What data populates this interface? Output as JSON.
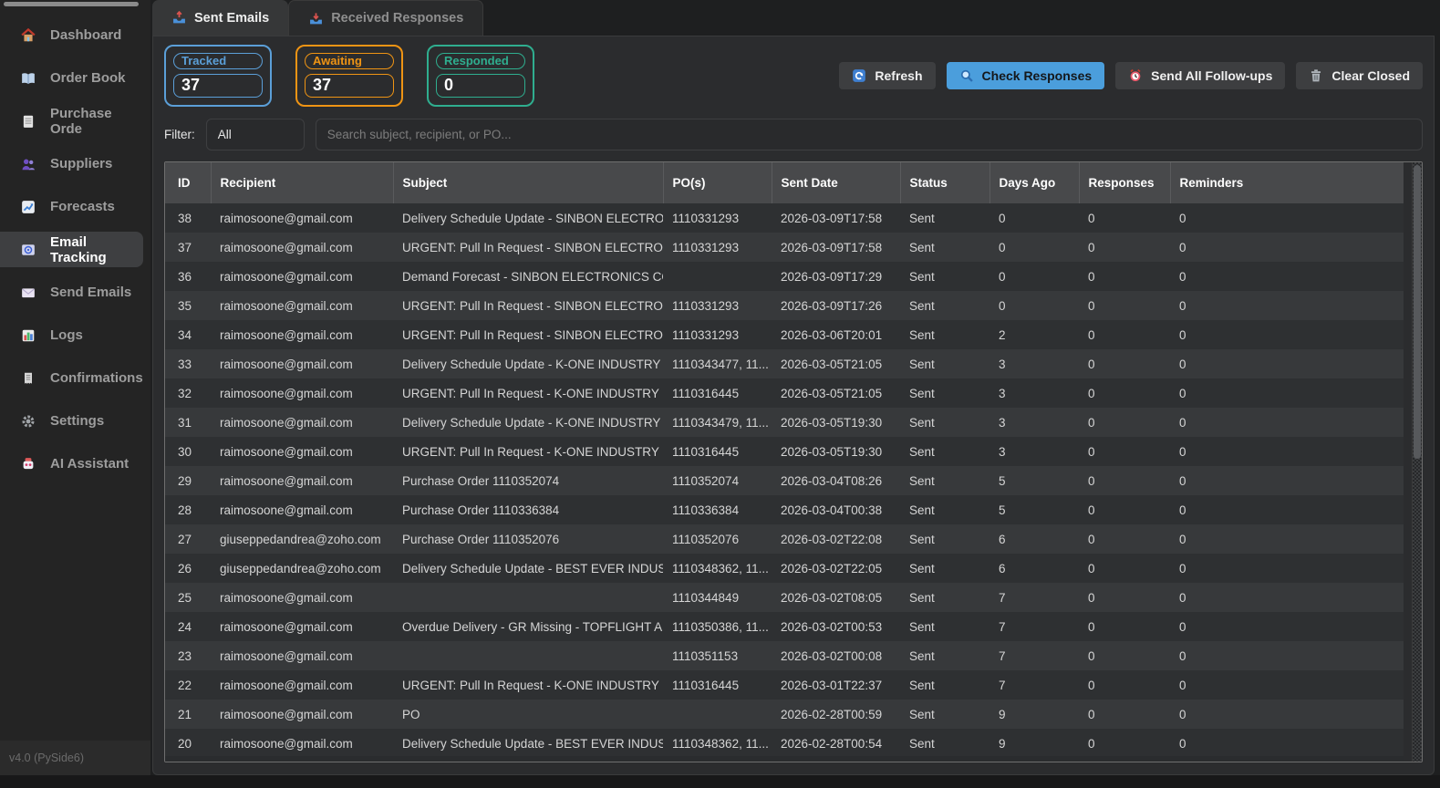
{
  "app": {
    "version_label": "v4.0 (PySide6)"
  },
  "sidebar": {
    "items": [
      {
        "slug": "dashboard",
        "label": "Dashboard",
        "icon": "house-icon",
        "active": false
      },
      {
        "slug": "order-book",
        "label": "Order Book",
        "icon": "book-icon",
        "active": false
      },
      {
        "slug": "purchase-orders",
        "label": "Purchase Orde",
        "icon": "clipboard-icon",
        "active": false
      },
      {
        "slug": "suppliers",
        "label": "Suppliers",
        "icon": "people-icon",
        "active": false
      },
      {
        "slug": "forecasts",
        "label": "Forecasts",
        "icon": "chart-up-icon",
        "active": false
      },
      {
        "slug": "email-tracking",
        "label": "Email Tracking",
        "icon": "email-tracking-icon",
        "active": true
      },
      {
        "slug": "send-emails",
        "label": "Send Emails",
        "icon": "envelope-icon",
        "active": false
      },
      {
        "slug": "logs",
        "label": "Logs",
        "icon": "bar-chart-icon",
        "active": false
      },
      {
        "slug": "confirmations",
        "label": "Confirmations",
        "icon": "receipt-icon",
        "active": false
      },
      {
        "slug": "settings",
        "label": "Settings",
        "icon": "gear-icon",
        "active": false
      },
      {
        "slug": "ai-assistant",
        "label": "AI Assistant",
        "icon": "robot-icon",
        "active": false
      }
    ]
  },
  "tabs": [
    {
      "slug": "sent-emails",
      "label": "Sent Emails",
      "icon": "outbox-icon",
      "active": true
    },
    {
      "slug": "received-responses",
      "label": "Received Responses",
      "icon": "inbox-icon",
      "active": false
    }
  ],
  "stats": [
    {
      "slug": "tracked",
      "label": "Tracked",
      "value": "37",
      "color": "#5b9fd8"
    },
    {
      "slug": "awaiting",
      "label": "Awaiting",
      "value": "37",
      "color": "#ef9414"
    },
    {
      "slug": "responded",
      "label": "Responded",
      "value": "0",
      "color": "#2fae8f"
    }
  ],
  "toolbar": {
    "primary_color": "#4b9edc",
    "buttons": [
      {
        "slug": "refresh",
        "label": "Refresh",
        "icon": "refresh-icon",
        "primary": false
      },
      {
        "slug": "check-responses",
        "label": "Check Responses",
        "icon": "search-icon",
        "primary": true
      },
      {
        "slug": "send-all-follow-ups",
        "label": "Send All Follow-ups",
        "icon": "alarm-icon",
        "primary": false
      },
      {
        "slug": "clear-closed",
        "label": "Clear Closed",
        "icon": "trash-icon",
        "primary": false
      }
    ]
  },
  "filter": {
    "label": "Filter:",
    "selected": "All",
    "search_placeholder": "Search subject, recipient, or PO..."
  },
  "table": {
    "columns": [
      {
        "slug": "id",
        "label": "ID"
      },
      {
        "slug": "recipient",
        "label": "Recipient"
      },
      {
        "slug": "subject",
        "label": "Subject"
      },
      {
        "slug": "pos",
        "label": "PO(s)"
      },
      {
        "slug": "sent-date",
        "label": "Sent Date"
      },
      {
        "slug": "status",
        "label": "Status"
      },
      {
        "slug": "days-ago",
        "label": "Days Ago"
      },
      {
        "slug": "responses",
        "label": "Responses"
      },
      {
        "slug": "reminders",
        "label": "Reminders"
      }
    ],
    "rows": [
      {
        "id": "38",
        "recipient": "raimosoone@gmail.com",
        "subject": "Delivery Schedule Update - SINBON ELECTRON...",
        "pos": "1110331293",
        "sent_date": "2026-03-09T17:58",
        "status": "Sent",
        "days_ago": "0",
        "responses": "0",
        "reminders": "0"
      },
      {
        "id": "37",
        "recipient": "raimosoone@gmail.com",
        "subject": "URGENT: Pull In Request - SINBON ELECTRONI...",
        "pos": "1110331293",
        "sent_date": "2026-03-09T17:58",
        "status": "Sent",
        "days_ago": "0",
        "responses": "0",
        "reminders": "0"
      },
      {
        "id": "36",
        "recipient": "raimosoone@gmail.com",
        "subject": "Demand Forecast - SINBON ELECTRONICS CO ...",
        "pos": "",
        "sent_date": "2026-03-09T17:29",
        "status": "Sent",
        "days_ago": "0",
        "responses": "0",
        "reminders": "0"
      },
      {
        "id": "35",
        "recipient": "raimosoone@gmail.com",
        "subject": "URGENT: Pull In Request - SINBON ELECTRONI...",
        "pos": "1110331293",
        "sent_date": "2026-03-09T17:26",
        "status": "Sent",
        "days_ago": "0",
        "responses": "0",
        "reminders": "0"
      },
      {
        "id": "34",
        "recipient": "raimosoone@gmail.com",
        "subject": "URGENT: Pull In Request - SINBON ELECTRONI...",
        "pos": "1110331293",
        "sent_date": "2026-03-06T20:01",
        "status": "Sent",
        "days_ago": "2",
        "responses": "0",
        "reminders": "0"
      },
      {
        "id": "33",
        "recipient": "raimosoone@gmail.com",
        "subject": "Delivery Schedule Update - K-ONE INDUSTRY ...",
        "pos": "1110343477, 11...",
        "sent_date": "2026-03-05T21:05",
        "status": "Sent",
        "days_ago": "3",
        "responses": "0",
        "reminders": "0"
      },
      {
        "id": "32",
        "recipient": "raimosoone@gmail.com",
        "subject": "URGENT: Pull In Request - K-ONE INDUSTRY S...",
        "pos": "1110316445",
        "sent_date": "2026-03-05T21:05",
        "status": "Sent",
        "days_ago": "3",
        "responses": "0",
        "reminders": "0"
      },
      {
        "id": "31",
        "recipient": "raimosoone@gmail.com",
        "subject": "Delivery Schedule Update - K-ONE INDUSTRY ...",
        "pos": "1110343479, 11...",
        "sent_date": "2026-03-05T19:30",
        "status": "Sent",
        "days_ago": "3",
        "responses": "0",
        "reminders": "0"
      },
      {
        "id": "30",
        "recipient": "raimosoone@gmail.com",
        "subject": "URGENT: Pull In Request - K-ONE INDUSTRY S...",
        "pos": "1110316445",
        "sent_date": "2026-03-05T19:30",
        "status": "Sent",
        "days_ago": "3",
        "responses": "0",
        "reminders": "0"
      },
      {
        "id": "29",
        "recipient": "raimosoone@gmail.com",
        "subject": "Purchase Order 1110352074",
        "pos": "1110352074",
        "sent_date": "2026-03-04T08:26",
        "status": "Sent",
        "days_ago": "5",
        "responses": "0",
        "reminders": "0"
      },
      {
        "id": "28",
        "recipient": "raimosoone@gmail.com",
        "subject": "Purchase Order 1110336384",
        "pos": "1110336384",
        "sent_date": "2026-03-04T00:38",
        "status": "Sent",
        "days_ago": "5",
        "responses": "0",
        "reminders": "0"
      },
      {
        "id": "27",
        "recipient": "giuseppedandrea@zoho.com",
        "subject": "Purchase Order 1110352076",
        "pos": "1110352076",
        "sent_date": "2026-03-02T22:08",
        "status": "Sent",
        "days_ago": "6",
        "responses": "0",
        "reminders": "0"
      },
      {
        "id": "26",
        "recipient": "giuseppedandrea@zoho.com",
        "subject": "Delivery Schedule Update - BEST EVER INDUST...",
        "pos": "1110348362, 11...",
        "sent_date": "2026-03-02T22:05",
        "status": "Sent",
        "days_ago": "6",
        "responses": "0",
        "reminders": "0"
      },
      {
        "id": "25",
        "recipient": "raimosoone@gmail.com",
        "subject": "",
        "pos": "1110344849",
        "sent_date": "2026-03-02T08:05",
        "status": "Sent",
        "days_ago": "7",
        "responses": "0",
        "reminders": "0"
      },
      {
        "id": "24",
        "recipient": "raimosoone@gmail.com",
        "subject": "Overdue Delivery - GR Missing - TOPFLIGHT AB...",
        "pos": "1110350386, 11...",
        "sent_date": "2026-03-02T00:53",
        "status": "Sent",
        "days_ago": "7",
        "responses": "0",
        "reminders": "0"
      },
      {
        "id": "23",
        "recipient": "raimosoone@gmail.com",
        "subject": "",
        "pos": "1110351153",
        "sent_date": "2026-03-02T00:08",
        "status": "Sent",
        "days_ago": "7",
        "responses": "0",
        "reminders": "0"
      },
      {
        "id": "22",
        "recipient": "raimosoone@gmail.com",
        "subject": "URGENT: Pull In Request - K-ONE INDUSTRY S...",
        "pos": "1110316445",
        "sent_date": "2026-03-01T22:37",
        "status": "Sent",
        "days_ago": "7",
        "responses": "0",
        "reminders": "0"
      },
      {
        "id": "21",
        "recipient": "raimosoone@gmail.com",
        "subject": "PO",
        "pos": "",
        "sent_date": "2026-02-28T00:59",
        "status": "Sent",
        "days_ago": "9",
        "responses": "0",
        "reminders": "0"
      },
      {
        "id": "20",
        "recipient": "raimosoone@gmail.com",
        "subject": "Delivery Schedule Update - BEST EVER INDUST...",
        "pos": "1110348362, 11...",
        "sent_date": "2026-02-28T00:54",
        "status": "Sent",
        "days_ago": "9",
        "responses": "0",
        "reminders": "0"
      }
    ]
  }
}
